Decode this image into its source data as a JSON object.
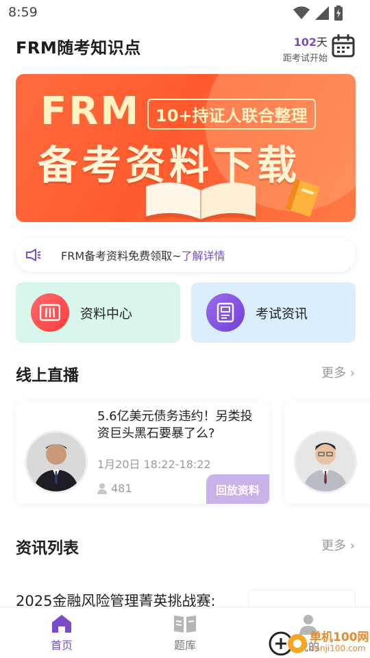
{
  "status_bar": {
    "time": "8:59"
  },
  "header": {
    "title": "FRM随考知识点",
    "countdown_days": "102",
    "countdown_unit": "天",
    "countdown_caption": "距考试开始"
  },
  "banner": {
    "frm_text": "FRM",
    "tag_text": "10+持证人联合整理",
    "main_text": "备考资料下载"
  },
  "notice": {
    "text": "FRM备考资料免费领取~",
    "link": "了解详情"
  },
  "quick_links": [
    {
      "label": "资料中心",
      "icon": "materials-icon"
    },
    {
      "label": "考试资讯",
      "icon": "news-document-icon"
    }
  ],
  "live_section": {
    "title": "线上直播",
    "more": "更多",
    "cards": [
      {
        "title": "5.6亿美元债务违约！另类投资巨头黑石要暴了么?",
        "time": "1月20日 18:22-18:22",
        "viewers": "481",
        "badge": "回放资料"
      }
    ]
  },
  "news_section": {
    "title": "资讯列表",
    "more": "更多",
    "items": [
      {
        "title": "2025金融风险管理菁英挑战赛:"
      }
    ]
  },
  "tab_bar": {
    "tabs": [
      {
        "label": "首页",
        "active": true
      },
      {
        "label": "题库",
        "active": false
      },
      {
        "label": "我的",
        "active": false
      }
    ]
  },
  "watermark": {
    "line1": "单机100网",
    "line2": "danji100.com"
  },
  "colors": {
    "accent": "#7a4bc9",
    "banner_orange": "#ff5a2e",
    "materials_bg": "#d9f6ec",
    "news_bg": "#dbeefd"
  }
}
